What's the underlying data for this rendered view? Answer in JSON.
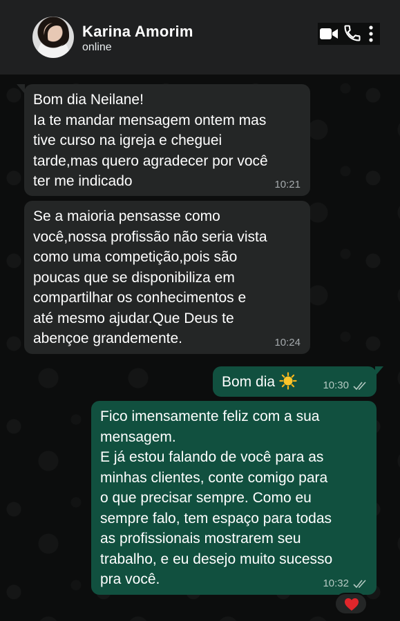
{
  "header": {
    "contact_name": "Karina Amorim",
    "status": "online",
    "icons": [
      "avatar",
      "video-call-icon",
      "phone-icon",
      "more-options-icon"
    ]
  },
  "messages": [
    {
      "direction": "incoming",
      "text": "Bom dia Neilane!\nIa te mandar mensagem ontem mas\ntive curso na igreja e cheguei\ntarde,mas quero agradecer por você\nter me indicado",
      "time": "10:21"
    },
    {
      "direction": "incoming",
      "text": "Se a maioria pensasse como\nvocê,nossa profissão não seria vista\ncomo uma competição,pois são\npoucas que se disponibiliza em\ncompartilhar os conhecimentos e\naté mesmo ajudar.Que Deus te\nabençoe grandemente.",
      "time": "10:24"
    },
    {
      "direction": "outgoing",
      "text": "Bom dia",
      "emoji_icon": "sun-icon",
      "time": "10:30",
      "status_icon": "double-check-icon"
    },
    {
      "direction": "outgoing",
      "text": "Fico imensamente feliz com a sua\nmensagem.\nE já estou falando de você para as\nminhas clientes, conte comigo para\no que precisar sempre. Como eu\nsempre falo, tem espaço para todas\nas profissionais mostrarem seu\ntrabalho, e eu desejo muito sucesso\npra você.",
      "time": "10:32",
      "status_icon": "double-check-icon",
      "reaction_icon": "red-heart-icon"
    }
  ],
  "colors": {
    "header_bg": "#1f2021",
    "chat_bg": "#0c0d0d",
    "incoming_bubble": "#242626",
    "outgoing_bubble": "#11503f",
    "reaction_heart": "#e0262b"
  }
}
